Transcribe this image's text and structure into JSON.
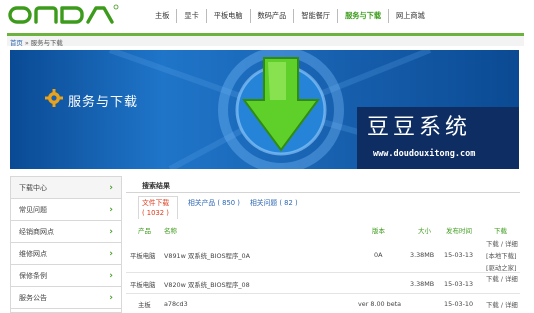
{
  "header": {
    "logo_text": "ONDA",
    "nav": [
      "主板",
      "显卡",
      "平板电脑",
      "数码产品",
      "智能餐厅",
      "服务与下载",
      "网上商城"
    ],
    "active_nav_index": 5,
    "accent_color": "#3c9b1b"
  },
  "breadcrumb": {
    "home": "首页",
    "separator": "»",
    "current": "服务与下载"
  },
  "banner": {
    "title": "服务与下载",
    "brand_cn": "豆豆系统",
    "brand_url": "www.doudouxitong.com"
  },
  "sidebar": {
    "items": [
      {
        "label": "下载中心"
      },
      {
        "label": "常见问题"
      },
      {
        "label": "经销商网点"
      },
      {
        "label": "维修网点"
      },
      {
        "label": "保修条例"
      },
      {
        "label": "服务公告"
      }
    ],
    "chevron": "›"
  },
  "results": {
    "title": "搜索结果",
    "tabs": [
      {
        "label": "文件下载",
        "count": "( 1032 )"
      },
      {
        "label": "相关产品 ( 850 )"
      },
      {
        "label": "相关问题 ( 82 )"
      }
    ],
    "columns": [
      "产品",
      "名称",
      "版本",
      "大小",
      "发布时间",
      "下载"
    ],
    "rows": [
      {
        "product": "平板电脑",
        "name": "V891w 双系统_BIOS程序_0A",
        "version": "0A",
        "size": "3.38MB",
        "date": "15-03-13",
        "links": [
          "下载 / 详细",
          "[本地下载]",
          "[驱动之家]"
        ]
      },
      {
        "product": "平板电脑",
        "name": "V820w 双系统_BIOS程序_08",
        "version": "",
        "size": "3.38MB",
        "date": "15-03-13",
        "links": [
          "下载 / 详细"
        ]
      },
      {
        "product": "主板",
        "name": "a78cd3",
        "version": "ver 8.00 beta",
        "size": "",
        "date": "15-03-10",
        "links": [
          "下载 / 详细"
        ]
      }
    ]
  }
}
